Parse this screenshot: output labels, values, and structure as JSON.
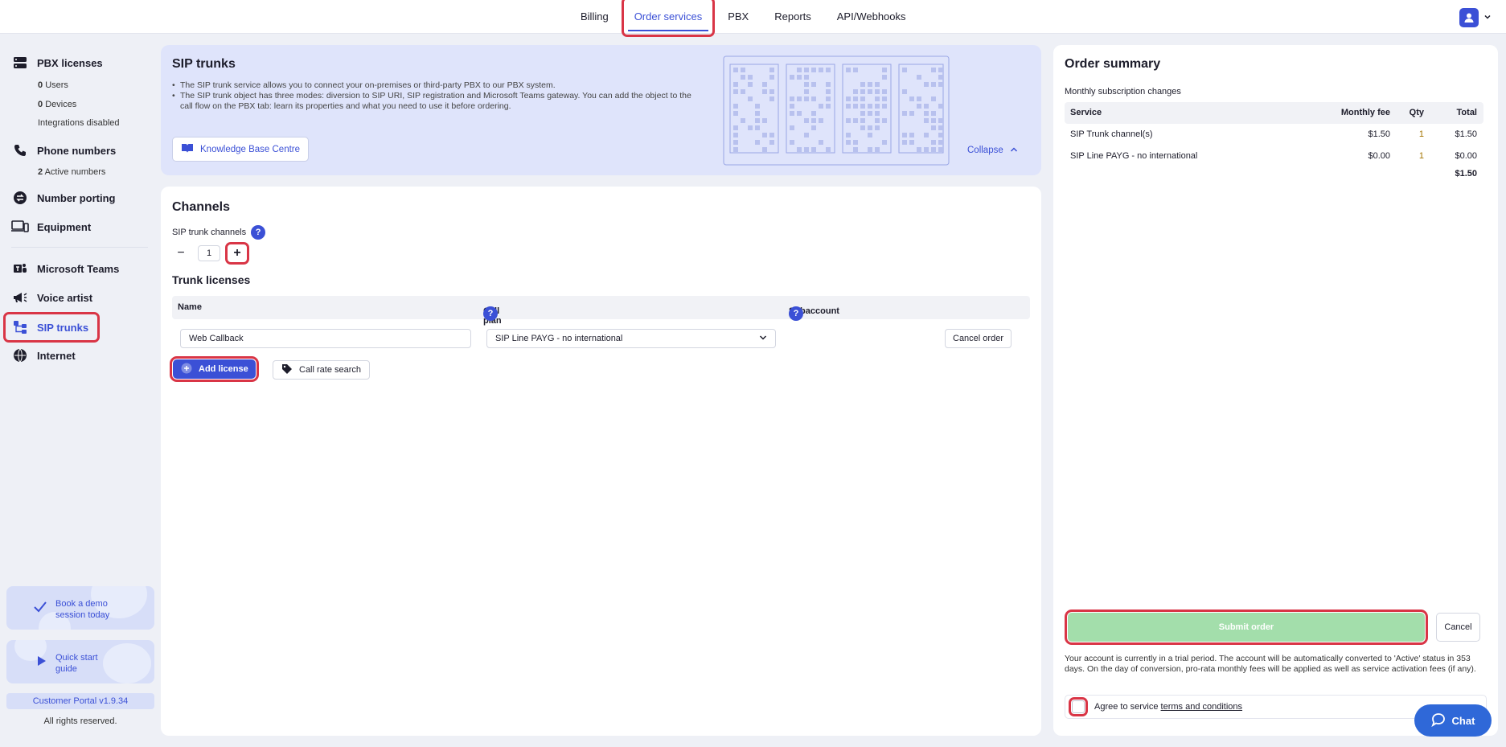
{
  "topnav": {
    "tabs": [
      {
        "label": "Billing"
      },
      {
        "label": "Order services"
      },
      {
        "label": "PBX"
      },
      {
        "label": "Reports"
      },
      {
        "label": "API/Webhooks"
      }
    ],
    "active_tab": "Order services"
  },
  "sidebar": {
    "pbx": {
      "label": "PBX licenses",
      "users_count": "0",
      "users_label": "Users",
      "devices_count": "0",
      "devices_label": "Devices",
      "integrations": "Integrations disabled"
    },
    "phone": {
      "label": "Phone numbers",
      "active_count": "2",
      "active_label": "Active numbers"
    },
    "porting": {
      "label": "Number porting"
    },
    "equipment": {
      "label": "Equipment"
    },
    "teams": {
      "label": "Microsoft Teams"
    },
    "voice": {
      "label": "Voice artist"
    },
    "sip": {
      "label": "SIP trunks"
    },
    "internet": {
      "label": "Internet"
    },
    "demo": {
      "line1": "Book a demo",
      "line2": "session today"
    },
    "guide": {
      "line1": "Quick start",
      "line2": "guide"
    },
    "version": "Customer Portal v1.9.34",
    "rights": "All rights reserved."
  },
  "info": {
    "title": "SIP trunks",
    "bullet1": "The SIP trunk service allows you to connect your on-premises or third-party PBX to our PBX system.",
    "bullet2": "The SIP trunk object has three modes: diversion to SIP URI, SIP registration and Microsoft Teams gateway. You can add the object to the call flow on the PBX tab: learn its properties and what you need to use it before ordering.",
    "kb_label": "Knowledge Base Centre",
    "collapse_label": "Collapse"
  },
  "channels": {
    "title": "Channels",
    "label": "SIP trunk channels",
    "value": "1",
    "minus": "−",
    "plus": "+"
  },
  "licenses": {
    "title": "Trunk licenses",
    "col_name": "Name",
    "col_plan": "Call plan",
    "col_sub": "Subaccount",
    "row": {
      "name": "Web Callback",
      "plan": "SIP Line PAYG - no international",
      "cancel": "Cancel order"
    },
    "add_label": "Add license",
    "rate_label": "Call rate search"
  },
  "summary": {
    "title": "Order summary",
    "monthly_label": "Monthly subscription changes",
    "headers": {
      "service": "Service",
      "fee": "Monthly fee",
      "qty": "Qty",
      "total": "Total"
    },
    "rows": [
      {
        "service": "SIP Trunk channel(s)",
        "fee": "$1.50",
        "qty": "1",
        "total": "$1.50"
      },
      {
        "service": "SIP Line PAYG - no international",
        "fee": "$0.00",
        "qty": "1",
        "total": "$0.00"
      }
    ],
    "grand_total": "$1.50",
    "submit_label": "Submit order",
    "cancel_label": "Cancel",
    "trial_text": "Your account is currently in a trial period. The account will be automatically converted to 'Active' status in 353 days. On the day of conversion, pro-rata monthly fees will be applied as well as service activation fees (if any).",
    "agree_text": "Agree to service",
    "terms_link": "terms and conditions"
  },
  "chat_label": "Chat",
  "colors": {
    "accent": "#3b50d6",
    "submit_disabled": "#a3deab",
    "highlight": "#d93546",
    "chat": "#2f68d8"
  }
}
